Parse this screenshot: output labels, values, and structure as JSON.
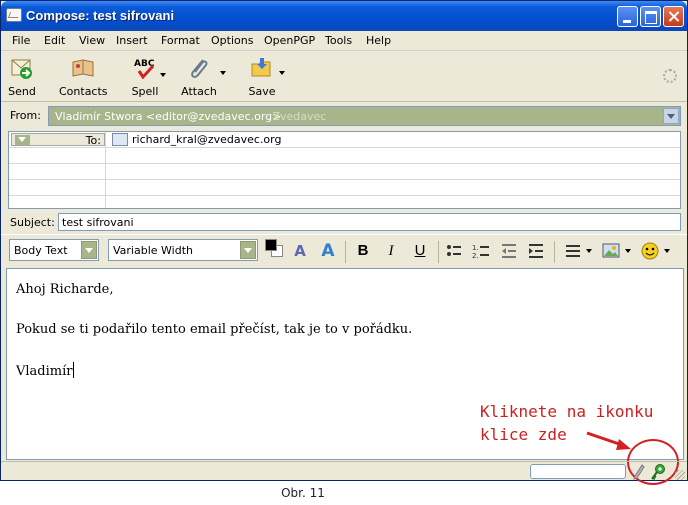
{
  "window": {
    "title": "Compose: test sifrovani"
  },
  "menu": [
    "File",
    "Edit",
    "View",
    "Insert",
    "Format",
    "Options",
    "OpenPGP",
    "Tools",
    "Help"
  ],
  "toolbar": {
    "send": "Send",
    "contacts": "Contacts",
    "spell": "Spell",
    "attach": "Attach",
    "save": "Save"
  },
  "from": {
    "label": "From:",
    "identity": "Vladimír Stwora <editor@zvedavec.org>",
    "account": "- Zvedavec"
  },
  "recipients": {
    "type_label": "To:",
    "address": "richard_kral@zvedavec.org"
  },
  "subject": {
    "label": "Subject:",
    "value": "test sifrovani"
  },
  "format": {
    "paragraph": "Body Text",
    "font": "Variable Width",
    "text_color": "#000000",
    "bg_color": "#ffffff",
    "bold": "B",
    "italic": "I",
    "underline": "U"
  },
  "body": {
    "line1": "Ahoj Richarde,",
    "line2": "Pokud se ti podařilo tento email přečíst, tak je to v pořádku.",
    "line3": "Vladimír"
  },
  "annotation": {
    "line1": "Kliknete na ikonku",
    "line2": "klice zde",
    "color": "#cc2020"
  },
  "caption": "Obr. 11"
}
